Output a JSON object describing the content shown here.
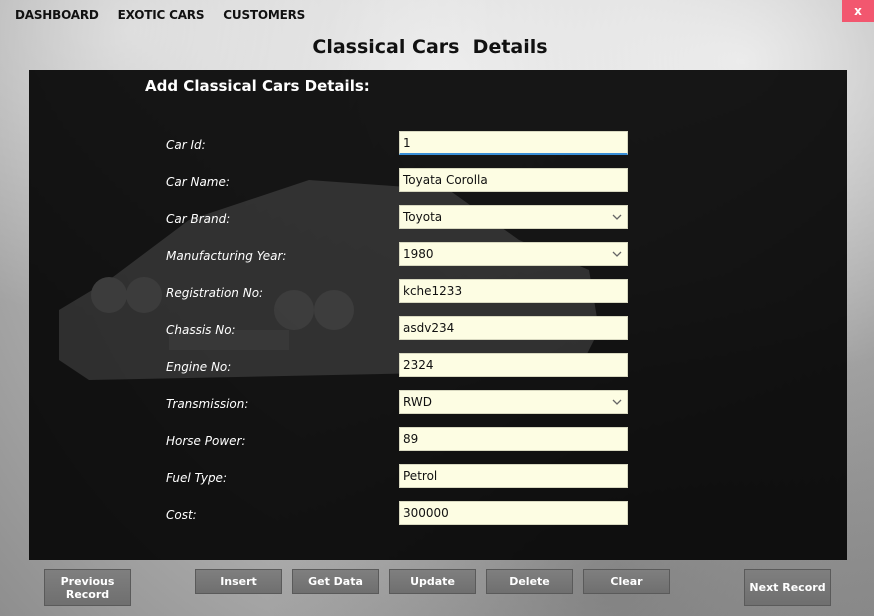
{
  "topnav": {
    "items": [
      {
        "label": "DASHBOARD"
      },
      {
        "label": "EXOTIC CARS"
      },
      {
        "label": "CUSTOMERS"
      }
    ]
  },
  "window": {
    "close_label": "x",
    "close_color": "#f2576f"
  },
  "page": {
    "title": "Classical Cars  Details"
  },
  "form": {
    "heading": "Add Classical Cars Details:",
    "fields": [
      {
        "label": "Car Id:",
        "value": "1",
        "type": "text"
      },
      {
        "label": "Car Name:",
        "value": "Toyata Corolla",
        "type": "text"
      },
      {
        "label": "Car Brand:",
        "value": "Toyota",
        "type": "select"
      },
      {
        "label": "Manufacturing Year:",
        "value": "1980",
        "type": "select"
      },
      {
        "label": "Registration No:",
        "value": "kche1233",
        "type": "text"
      },
      {
        "label": "Chassis No:",
        "value": "asdv234",
        "type": "text"
      },
      {
        "label": "Engine No:",
        "value": "2324",
        "type": "text"
      },
      {
        "label": "Transmission:",
        "value": "RWD",
        "type": "select"
      },
      {
        "label": "Horse Power:",
        "value": "89",
        "type": "text"
      },
      {
        "label": "Fuel Type:",
        "value": "Petrol",
        "type": "text"
      },
      {
        "label": "Cost:",
        "value": "300000",
        "type": "text"
      }
    ]
  },
  "buttons": {
    "previous": "Previous Record",
    "insert": "Insert",
    "get_data": "Get Data",
    "update": "Update",
    "delete": "Delete",
    "clear": "Clear",
    "next": "Next Record"
  },
  "colors": {
    "panel_bg": "#050505",
    "input_bg": "#fdfde3",
    "button_bg": "#777777",
    "focus_accent": "#3a8fd8"
  },
  "icons": {
    "dropdown": "chevron-down-icon",
    "close": "close-icon"
  }
}
